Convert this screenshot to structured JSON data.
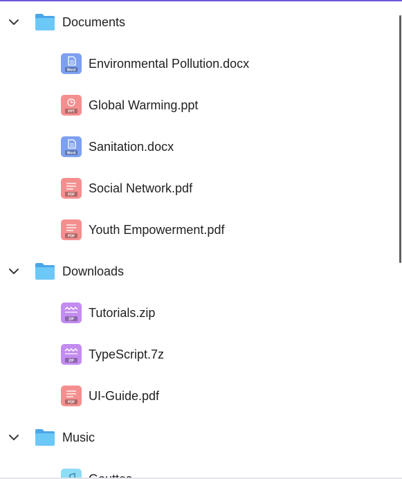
{
  "tree": {
    "folders": [
      {
        "name": "Documents",
        "expanded": true,
        "files": [
          {
            "name": "Environmental Pollution.docx",
            "type": "word",
            "badge": "Word",
            "icon": "word-file-icon"
          },
          {
            "name": "Global Warming.ppt",
            "type": "ppt",
            "badge": "PPT",
            "icon": "ppt-file-icon"
          },
          {
            "name": "Sanitation.docx",
            "type": "word",
            "badge": "Word",
            "icon": "word-file-icon"
          },
          {
            "name": "Social Network.pdf",
            "type": "pdf",
            "badge": "PDF",
            "icon": "pdf-file-icon"
          },
          {
            "name": "Youth Empowerment.pdf",
            "type": "pdf",
            "badge": "PDF",
            "icon": "pdf-file-icon"
          }
        ]
      },
      {
        "name": "Downloads",
        "expanded": true,
        "files": [
          {
            "name": "Tutorials.zip",
            "type": "zip",
            "badge": "ZIP",
            "icon": "zip-file-icon"
          },
          {
            "name": "TypeScript.7z",
            "type": "zip",
            "badge": "ZIP",
            "icon": "zip-file-icon"
          },
          {
            "name": "UI-Guide.pdf",
            "type": "pdf",
            "badge": "PDF",
            "icon": "pdf-file-icon"
          }
        ]
      },
      {
        "name": "Music",
        "expanded": true,
        "files": [
          {
            "name": "Gouttes",
            "type": "audio",
            "badge": "",
            "icon": "audio-file-icon"
          }
        ]
      }
    ]
  },
  "colors": {
    "accent_top_border": "#6b57d9",
    "folder": "#6cc8f6",
    "folder_back": "#4aa6e8",
    "word": "#7da0f0",
    "ppt": "#f58f8f",
    "pdf": "#f58f8f",
    "zip": "#c38cf0",
    "audio": "#8fdcf5",
    "text": "#1f1f1f"
  }
}
